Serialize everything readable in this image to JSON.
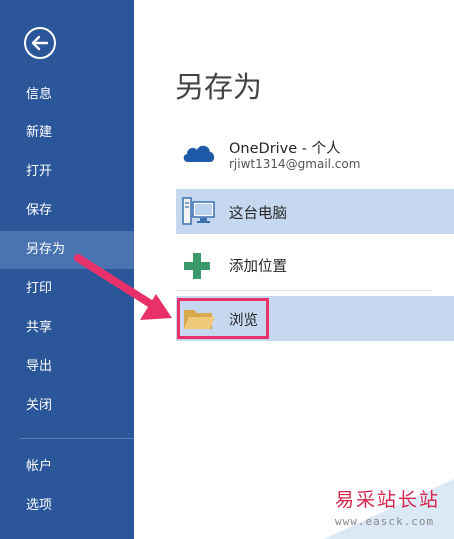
{
  "sidebar": {
    "back_icon": "back-arrow-circle-icon",
    "items": [
      {
        "label": "信息"
      },
      {
        "label": "新建"
      },
      {
        "label": "打开"
      },
      {
        "label": "保存"
      },
      {
        "label": "另存为",
        "active": true
      },
      {
        "label": "打印"
      },
      {
        "label": "共享"
      },
      {
        "label": "导出"
      },
      {
        "label": "关闭"
      },
      {
        "label": "帐户"
      },
      {
        "label": "选项"
      }
    ]
  },
  "main": {
    "title": "另存为",
    "options": {
      "onedrive": {
        "label": "OneDrive - 个人",
        "account": "rjiwt1314@gmail.com",
        "icon": "cloud-icon"
      },
      "this_pc": {
        "label": "这台电脑",
        "icon": "computer-icon"
      },
      "add_place": {
        "label": "添加位置",
        "icon": "plus-icon"
      },
      "browse": {
        "label": "浏览",
        "icon": "folder-icon"
      }
    }
  },
  "watermark": {
    "text": "易采站长站",
    "url": "www.easck.com"
  },
  "colors": {
    "sidebar_bg": "#2b579a",
    "sidebar_active": "#4a73b1",
    "selected_bg": "#c5d8f0",
    "highlight": "#e8306a"
  }
}
